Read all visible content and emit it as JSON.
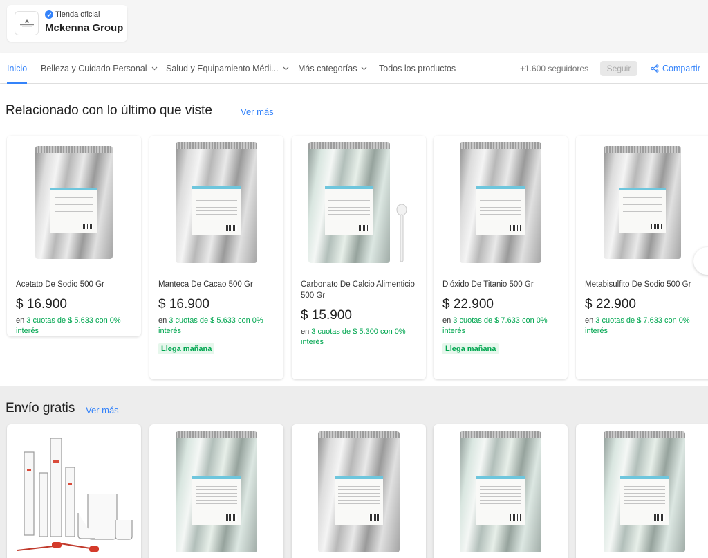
{
  "brand": {
    "official_label": "Tienda oficial",
    "name": "Mckenna Group"
  },
  "nav": {
    "items": [
      {
        "label": "Inicio",
        "active": true
      },
      {
        "label": "Belleza y Cuidado Personal",
        "dropdown": true
      },
      {
        "label": "Salud y Equipamiento Médi...",
        "dropdown": true
      },
      {
        "label": "Más categorías",
        "dropdown": true
      },
      {
        "label": "Todos los productos"
      }
    ],
    "followers": "+1.600 seguidores",
    "follow_label": "Seguir",
    "share_label": "Compartir"
  },
  "section_recent": {
    "title": "Relacionado con lo último que viste",
    "link": "Ver más",
    "products": [
      {
        "title": "Acetato De Sodio 500 Gr",
        "price": "$ 16.900",
        "inst_prefix": "en ",
        "inst_highlight": "3 cuotas de $ 5.633 con 0% interés",
        "badge": ""
      },
      {
        "title": "Manteca De Cacao 500 Gr",
        "price": "$ 16.900",
        "inst_prefix": "en ",
        "inst_highlight": "3 cuotas de $ 5.633 con 0% interés",
        "badge": "Llega mañana"
      },
      {
        "title": "Carbonato De Calcio Alimenticio 500 Gr",
        "price": "$ 15.900",
        "inst_prefix": "en ",
        "inst_highlight": "3 cuotas de $ 5.300 con 0% interés",
        "badge": ""
      },
      {
        "title": "Dióxido De Titanio 500 Gr",
        "price": "$ 22.900",
        "inst_prefix": "en ",
        "inst_highlight": "3 cuotas de $ 7.633 con 0% interés",
        "badge": "Llega mañana"
      },
      {
        "title": "Metabisulfito De Sodio 500 Gr",
        "price": "$ 22.900",
        "inst_prefix": "en ",
        "inst_highlight": "3 cuotas de $ 7.633 con 0% interés",
        "badge": ""
      }
    ]
  },
  "section_free": {
    "title": "Envío gratis",
    "link": "Ver más"
  },
  "colors": {
    "accent": "#3483fa",
    "green": "#00a650"
  }
}
